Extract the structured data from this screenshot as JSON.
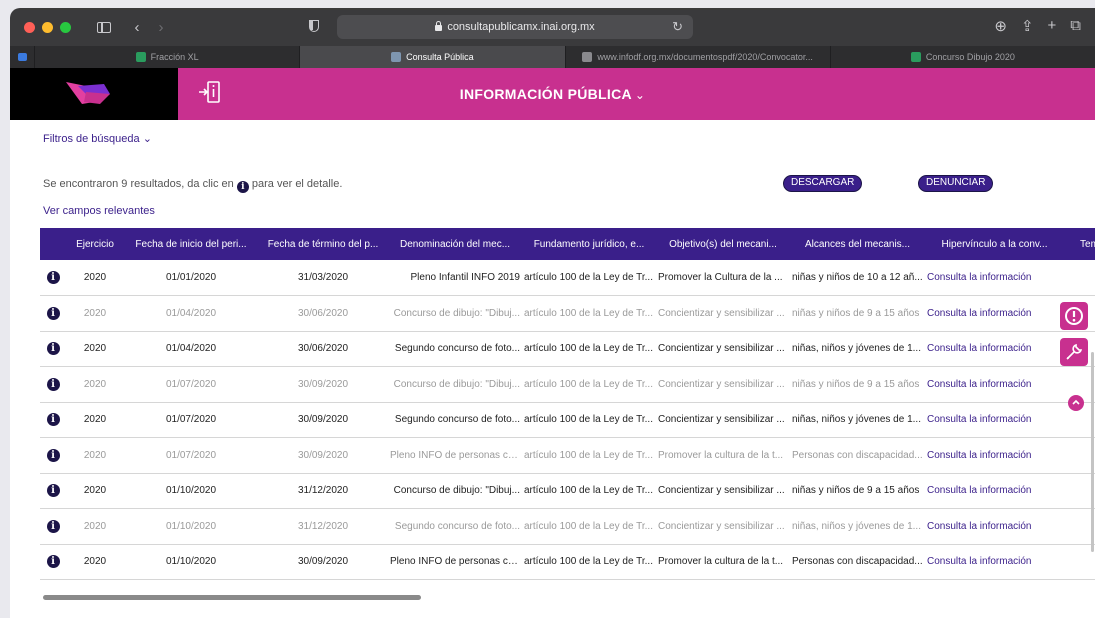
{
  "browser": {
    "url": "consultapublicamx.inai.org.mx",
    "tabs": [
      {
        "label": "Fracción XL",
        "favicon": "inai-icon",
        "active": false
      },
      {
        "label": "Consulta Pública",
        "favicon": "grid-icon",
        "active": true
      },
      {
        "label": "www.infodf.org.mx/documentospdf/2020/Convocator...",
        "favicon": "document-icon",
        "active": false
      },
      {
        "label": "Concurso Dibujo 2020",
        "favicon": "inai-icon",
        "active": false
      }
    ]
  },
  "header": {
    "title": "INFORMACIÓN PÚBLICA",
    "chevron": "⌄"
  },
  "filters": {
    "label": "Filtros de búsqueda",
    "chevron": "⌄"
  },
  "results": {
    "prefix": "Se encontraron 9 resultados, da clic en",
    "icon": "i",
    "suffix": "para ver el detalle."
  },
  "ver_campos": "Ver campos relevantes",
  "buttons": {
    "descargar": "DESCARGAR",
    "denunciar": "DENUNCIAR"
  },
  "table": {
    "headers": [
      "",
      "Ejercicio",
      "Fecha de inicio del peri...",
      "Fecha de término del p...",
      "Denominación del mec...",
      "Fundamento jurídico, e...",
      "Objetivo(s) del mecani...",
      "Alcances del mecanis...",
      "Hipervínculo a la conv...",
      "Tem"
    ],
    "rows": [
      {
        "dim": false,
        "ejercicio": "2020",
        "inicio": "01/01/2020",
        "termino": "31/03/2020",
        "denominacion": "Pleno Infantil INFO 2019",
        "fundamento": "artículo 100 de la Ley de Tr...",
        "objetivo": "Promover la Cultura de la ...",
        "alcances": "niñas y niños de 10 a 12 añ...",
        "hipervinculo": "Consulta la información"
      },
      {
        "dim": true,
        "ejercicio": "2020",
        "inicio": "01/04/2020",
        "termino": "30/06/2020",
        "denominacion": "Concurso de dibujo: \"Dibuj...",
        "fundamento": "artículo 100 de la Ley de Tr...",
        "objetivo": "Concientizar y sensibilizar ...",
        "alcances": "niñas y niños de 9 a 15 años",
        "hipervinculo": "Consulta la información"
      },
      {
        "dim": false,
        "ejercicio": "2020",
        "inicio": "01/04/2020",
        "termino": "30/06/2020",
        "denominacion": "Segundo concurso de foto...",
        "fundamento": "artículo 100 de la Ley de Tr...",
        "objetivo": "Concientizar y sensibilizar ...",
        "alcances": "niñas, niños y jóvenes de 1...",
        "hipervinculo": "Consulta la información"
      },
      {
        "dim": true,
        "ejercicio": "2020",
        "inicio": "01/07/2020",
        "termino": "30/09/2020",
        "denominacion": "Concurso de dibujo: \"Dibuj...",
        "fundamento": "artículo 100 de la Ley de Tr...",
        "objetivo": "Concientizar y sensibilizar ...",
        "alcances": "niñas y niños de 9 a 15 años",
        "hipervinculo": "Consulta la información"
      },
      {
        "dim": false,
        "ejercicio": "2020",
        "inicio": "01/07/2020",
        "termino": "30/09/2020",
        "denominacion": "Segundo concurso de foto...",
        "fundamento": "artículo 100 de la Ley de Tr...",
        "objetivo": "Concientizar y sensibilizar ...",
        "alcances": "niñas, niños y jóvenes de 1...",
        "hipervinculo": "Consulta la información"
      },
      {
        "dim": true,
        "ejercicio": "2020",
        "inicio": "01/07/2020",
        "termino": "30/09/2020",
        "denominacion": "Pleno INFO de personas co...",
        "fundamento": "artículo 100 de la Ley de Tr...",
        "objetivo": "Promover la cultura de la t...",
        "alcances": "Personas con discapacidad...",
        "hipervinculo": "Consulta la información"
      },
      {
        "dim": false,
        "ejercicio": "2020",
        "inicio": "01/10/2020",
        "termino": "31/12/2020",
        "denominacion": "Concurso de dibujo: \"Dibuj...",
        "fundamento": "artículo 100 de la Ley de Tr...",
        "objetivo": "Concientizar y sensibilizar ...",
        "alcances": "niñas y niños de 9 a 15 años",
        "hipervinculo": "Consulta la información"
      },
      {
        "dim": true,
        "ejercicio": "2020",
        "inicio": "01/10/2020",
        "termino": "31/12/2020",
        "denominacion": "Segundo concurso de foto...",
        "fundamento": "artículo 100 de la Ley de Tr...",
        "objetivo": "Concientizar y sensibilizar ...",
        "alcances": "niñas, niños y jóvenes de 1...",
        "hipervinculo": "Consulta la información"
      },
      {
        "dim": false,
        "ejercicio": "2020",
        "inicio": "01/10/2020",
        "termino": "30/09/2020",
        "denominacion": "Pleno INFO de personas co...",
        "fundamento": "artículo 100 de la Ley de Tr...",
        "objetivo": "Promover la cultura de la t...",
        "alcances": "Personas con discapacidad...",
        "hipervinculo": "Consulta la información"
      }
    ]
  },
  "floating": {
    "alert": "exclamation-icon",
    "tools": "wrench-icon",
    "up": "arrow-up-icon"
  },
  "colors": {
    "brand_magenta": "#c8308f",
    "brand_purple": "#3a1f8a",
    "dark_navy": "#1c1548"
  }
}
